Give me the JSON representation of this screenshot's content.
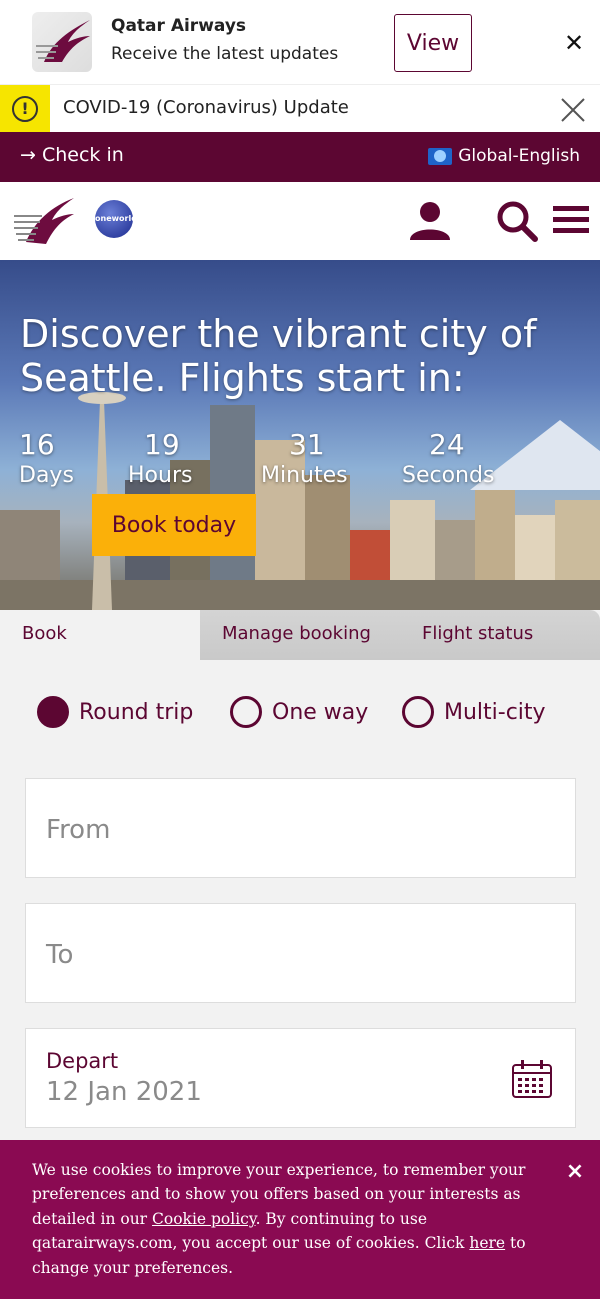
{
  "app_banner": {
    "title": "Qatar Airways",
    "subtitle": "Receive the latest updates",
    "view_label": "View",
    "close_icon": "close-icon"
  },
  "covid": {
    "text": "COVID-19 (Coronavirus) Update",
    "icon": "alert-icon",
    "icon_glyph": "!"
  },
  "topnav": {
    "checkin": "Check in",
    "checkin_arrow": "→",
    "language": "Global-English"
  },
  "header": {
    "oneworld": "oneworld"
  },
  "hero": {
    "title": "Discover the vibrant city of Seattle. Flights start in:",
    "countdown": [
      {
        "num": "16",
        "label": "Days"
      },
      {
        "num": "19",
        "label": "Hours"
      },
      {
        "num": "31",
        "label": "Minutes"
      },
      {
        "num": "24",
        "label": "Seconds"
      }
    ],
    "cta": "Book today"
  },
  "tabs": [
    {
      "label": "Book",
      "active": true
    },
    {
      "label": "Manage booking",
      "active": false
    },
    {
      "label": "Flight status",
      "active": false
    }
  ],
  "trip_types": [
    {
      "label": "Round trip",
      "selected": true
    },
    {
      "label": "One way",
      "selected": false
    },
    {
      "label": "Multi-city",
      "selected": false
    }
  ],
  "form": {
    "from_placeholder": "From",
    "to_placeholder": "To",
    "depart_label": "Depart",
    "depart_value": "12 Jan 2021"
  },
  "cookie": {
    "text_1": "We use cookies to improve your experience, to remember your preferences and to show you offers based on your interests as detailed in our ",
    "policy_link": "Cookie policy",
    "text_2": ". By continuing to use qatarairways.com, you accept our use of cookies. Click ",
    "here_link": "here",
    "text_3": " to change your preferences.",
    "close": "×"
  },
  "colors": {
    "brand_purple": "#5c0632",
    "cookie_purple": "#8a0a52",
    "cta_yellow": "#fbb009",
    "alert_yellow": "#f6e500"
  }
}
